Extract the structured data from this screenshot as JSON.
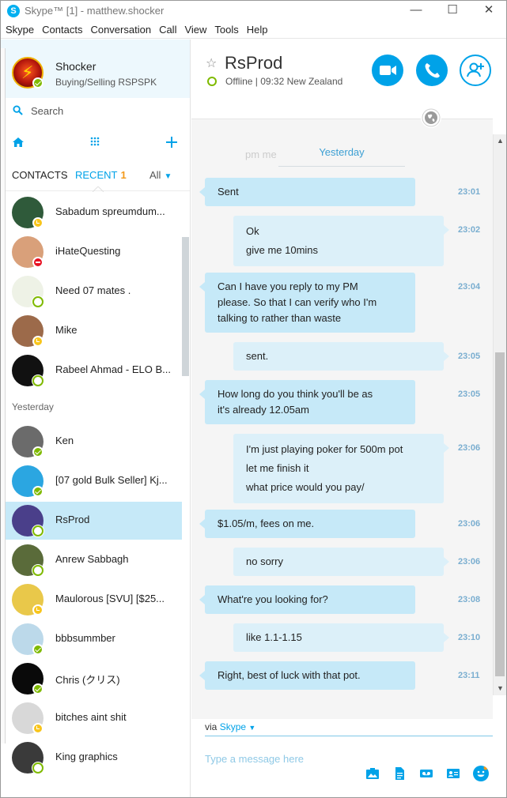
{
  "window": {
    "title": "Skype™ [1] - matthew.shocker",
    "app_icon_letter": "S",
    "controls": {
      "minimize": "—",
      "maximize": "☐",
      "close": "✕"
    }
  },
  "menu": [
    "Skype",
    "Contacts",
    "Conversation",
    "Call",
    "View",
    "Tools",
    "Help"
  ],
  "profile": {
    "name": "Shocker",
    "mood": "Buying/Selling RSPSPK",
    "status": "online"
  },
  "search": {
    "placeholder": "Search"
  },
  "contact_tabs": {
    "contacts": "CONTACTS",
    "recent": "RECENT",
    "recent_count": "1",
    "filter": "All"
  },
  "sections": {
    "yesterday": "Yesterday"
  },
  "contacts": [
    {
      "name": "Sabadum spreumdum...",
      "status": "away",
      "avatar_color": "#2f5a3a"
    },
    {
      "name": "iHateQuesting",
      "status": "dnd",
      "avatar_color": "#d9a07a"
    },
    {
      "name": "Need 07 mates .",
      "status": "offline",
      "avatar_color": "#eef2e6"
    },
    {
      "name": "Mike",
      "status": "away",
      "avatar_color": "#9c6a4a"
    },
    {
      "name": "Rabeel Ahmad - ELO B...",
      "status": "offline",
      "avatar_color": "#111111"
    },
    {
      "name": "Ken",
      "status": "online",
      "avatar_color": "#6b6b6b"
    },
    {
      "name": "[07 gold Bulk Seller] Kj...",
      "status": "online",
      "avatar_color": "#2ba6e1"
    },
    {
      "name": "RsProd",
      "status": "offline",
      "avatar_color": "#4a3f8a",
      "selected": true
    },
    {
      "name": "Anrew Sabbagh",
      "status": "offline",
      "avatar_color": "#5a6b3a"
    },
    {
      "name": "Maulorous [SVU] [$25...",
      "status": "away",
      "avatar_color": "#e9c84a"
    },
    {
      "name": "bbbsummber",
      "status": "online",
      "avatar_color": "#bcd9ea"
    },
    {
      "name": "Chris (クリス)",
      "status": "online",
      "avatar_color": "#0a0a0a"
    },
    {
      "name": "bitches aint shit",
      "status": "away",
      "avatar_color": "#d8d8d8"
    },
    {
      "name": "King graphics",
      "status": "offline",
      "avatar_color": "#3a3a3a"
    }
  ],
  "conversation": {
    "name": "RsProd",
    "status_text": "Offline  |  09:32 New Zealand",
    "date_label": "Yesterday",
    "ghost_text": "pm me",
    "messages": [
      {
        "dir": "in",
        "lines": [
          "Sent"
        ],
        "time": "23:01"
      },
      {
        "dir": "out",
        "lines": [
          "Ok",
          "give me 10mins"
        ],
        "time": "23:02"
      },
      {
        "dir": "in",
        "lines": [
          "Can I have you reply to my PM",
          "please. So that I can verify who I'm",
          "talking to rather than waste"
        ],
        "time": "23:04"
      },
      {
        "dir": "out",
        "lines": [
          "sent."
        ],
        "time": "23:05"
      },
      {
        "dir": "in",
        "lines": [
          "How long do you think you'll be as",
          "it's already 12.05am"
        ],
        "time": "23:05"
      },
      {
        "dir": "out",
        "lines": [
          "I'm just playing poker for 500m pot",
          "let me finish it",
          "what price would you pay/"
        ],
        "time": "23:06"
      },
      {
        "dir": "in",
        "lines": [
          "$1.05/m, fees on me."
        ],
        "time": "23:06"
      },
      {
        "dir": "out",
        "lines": [
          "no sorry"
        ],
        "time": "23:06"
      },
      {
        "dir": "in",
        "lines": [
          "What're you looking for?"
        ],
        "time": "23:08"
      },
      {
        "dir": "out",
        "lines": [
          "like 1.1-1.15"
        ],
        "time": "23:10"
      },
      {
        "dir": "in",
        "lines": [
          "Right, best of luck with that pot."
        ],
        "time": "23:11"
      }
    ]
  },
  "composer": {
    "via_prefix": "via",
    "via_service": "Skype",
    "placeholder": "Type a message here"
  },
  "colors": {
    "accent": "#00a2e8",
    "bubble_in": "#c6e9f8",
    "bubble_out": "#dcf0f9",
    "online": "#7fba00",
    "away": "#f8c51c",
    "dnd": "#e81123"
  }
}
